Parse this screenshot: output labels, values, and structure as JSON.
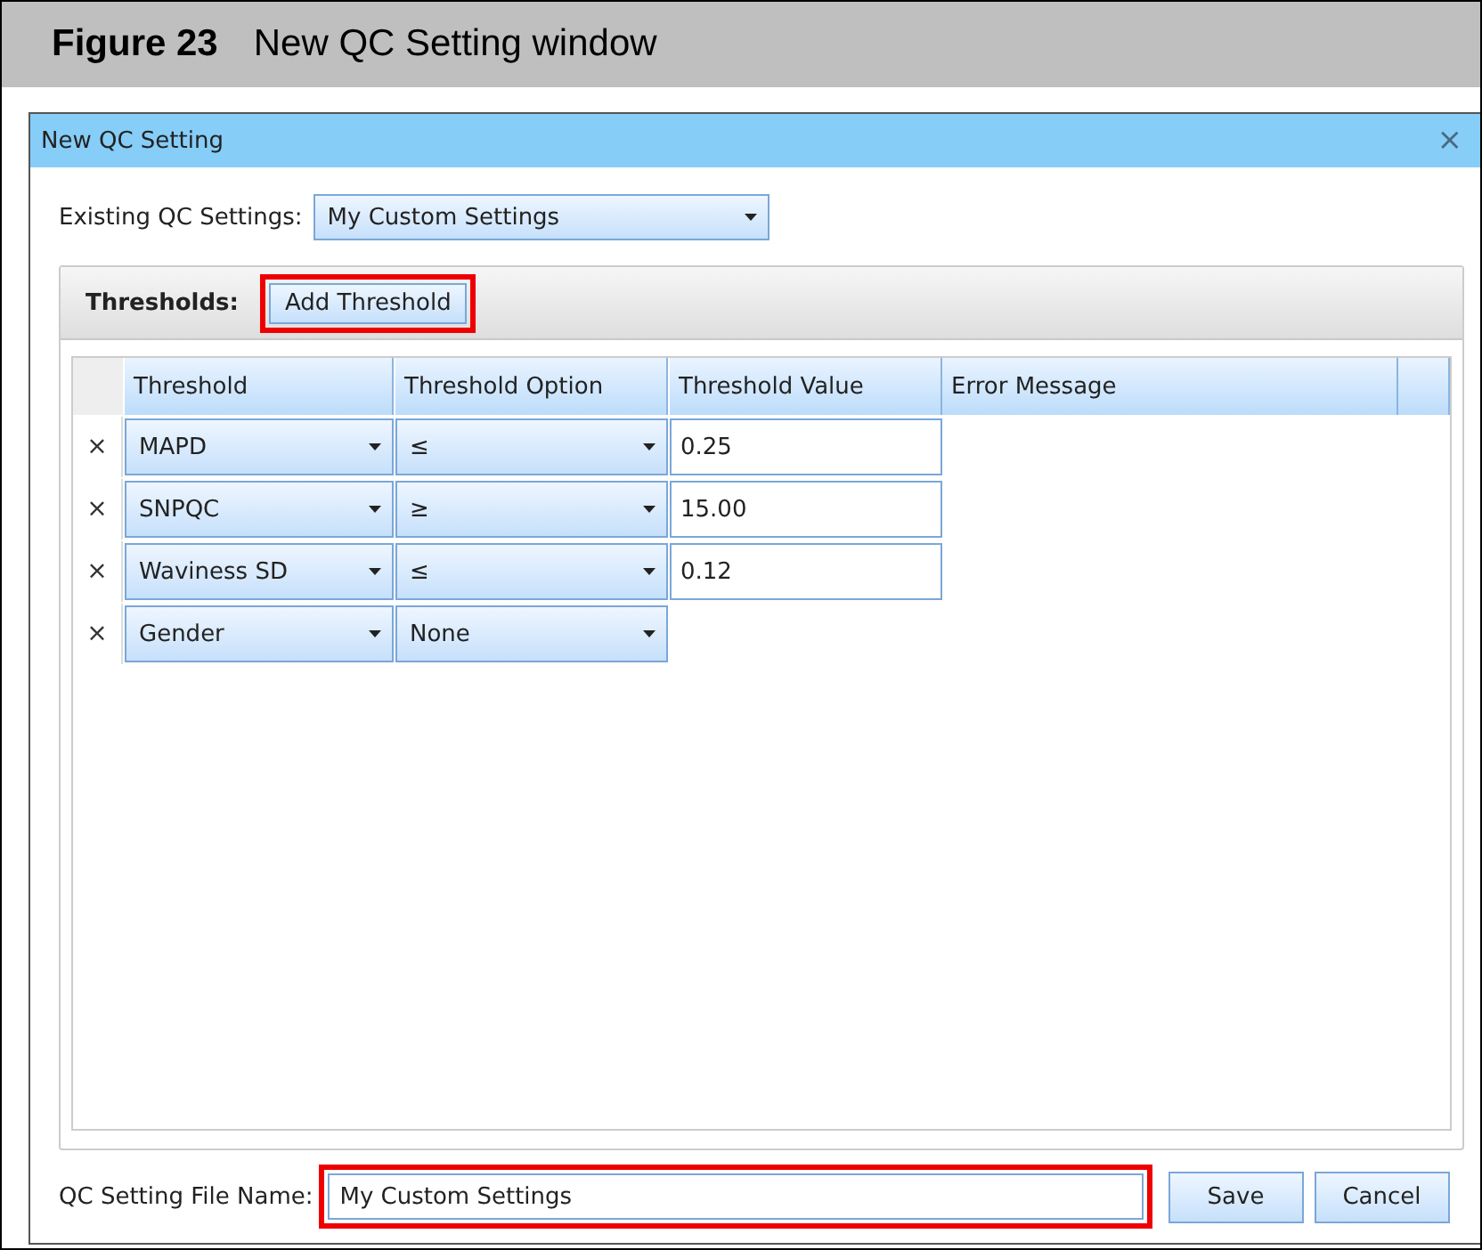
{
  "figure": {
    "label": "Figure 23",
    "caption": "New QC Setting window"
  },
  "window": {
    "title": "New QC Setting",
    "close": "×"
  },
  "existing": {
    "label": "Existing QC Settings:",
    "value": "My Custom Settings"
  },
  "thresholds": {
    "label": "Thresholds:",
    "add_button": {
      "label": "Add Threshold",
      "highlighted": true
    },
    "columns": [
      "Threshold",
      "Threshold Option",
      "Threshold Value",
      "Error Message"
    ],
    "rows": [
      {
        "remove": "×",
        "threshold": "MAPD",
        "option": "≤",
        "value": "0.25"
      },
      {
        "remove": "×",
        "threshold": "SNPQC",
        "option": "≥",
        "value": "15.00"
      },
      {
        "remove": "×",
        "threshold": "Waviness SD",
        "option": "≤",
        "value": "0.12"
      },
      {
        "remove": "×",
        "threshold": "Gender",
        "option": "None"
      }
    ]
  },
  "file_name": {
    "label": "QC Setting File Name:",
    "value": "My Custom Settings",
    "highlighted": true
  },
  "buttons": [
    "Save",
    "Cancel"
  ]
}
